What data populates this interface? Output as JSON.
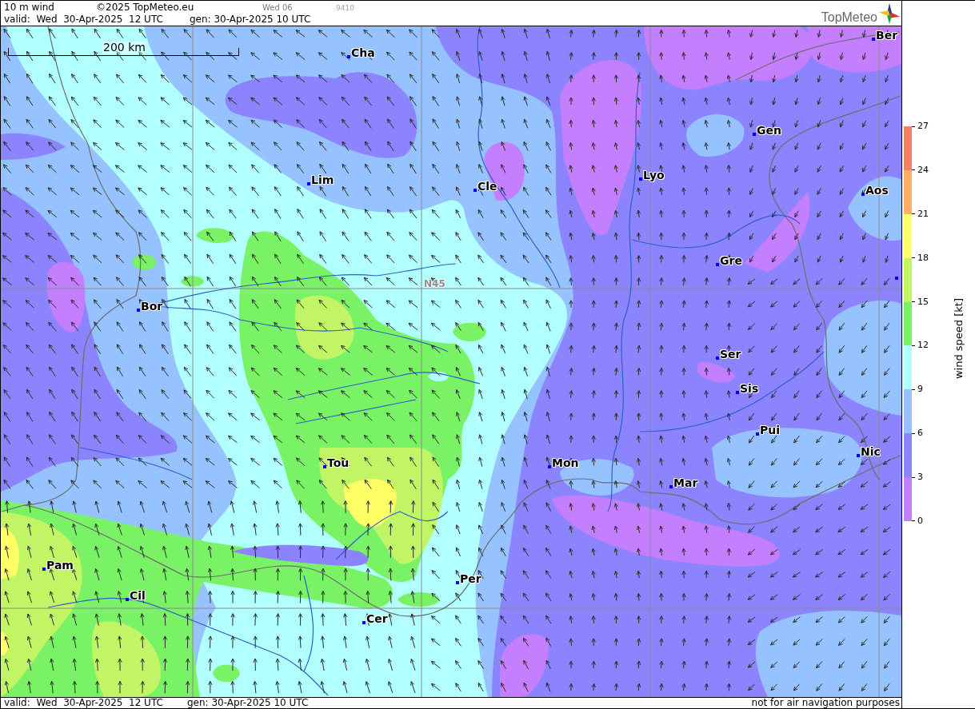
{
  "header": {
    "title": "10 m wind",
    "copyright": "©2025 TopMeteo.eu",
    "run_day": "Wed 06",
    "run_code": "9410",
    "valid": "valid:  Wed  30-Apr-2025  12 UTC",
    "generated": "gen: 30-Apr-2025 10 UTC"
  },
  "logo": {
    "text": "TopMeteo"
  },
  "map": {
    "scale_label": "200 km",
    "grid_label": "N45",
    "cities": [
      "Ber",
      "Cha",
      "Gen",
      "Lyo",
      "Lim",
      "Cle",
      "Aos",
      "Gre",
      "Bor",
      "Ser",
      "Sis",
      "Pui",
      "Nic",
      "Tou",
      "Mon",
      "Mar",
      "Pam",
      "Per",
      "Cil",
      "Cer"
    ]
  },
  "legend": {
    "title": "wind speed [kt]",
    "bands": [
      {
        "color": "#f08066"
      },
      {
        "color": "#ffb066"
      },
      {
        "color": "#ffff66"
      },
      {
        "color": "#c2f566"
      },
      {
        "color": "#7af266"
      },
      {
        "color": "#b2ffff"
      },
      {
        "color": "#96c3ff"
      },
      {
        "color": "#8c84ff"
      },
      {
        "color": "#c47fff"
      }
    ],
    "ticks": [
      "27",
      "24",
      "21",
      "18",
      "15",
      "12",
      "9",
      "6",
      "3",
      "0"
    ]
  },
  "footer": {
    "valid": "valid:  Wed  30-Apr-2025  12 UTC",
    "generated": "gen: 30-Apr-2025 10 UTC",
    "disclaimer": "not for air navigation purposes"
  }
}
